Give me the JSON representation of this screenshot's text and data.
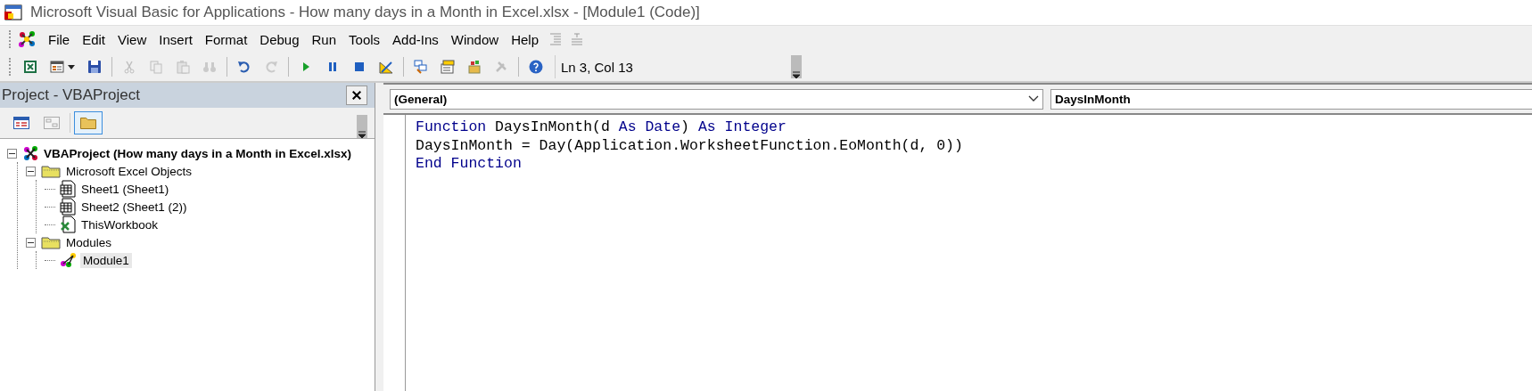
{
  "window": {
    "title": "Microsoft Visual Basic for Applications - How many days in a Month in Excel.xlsx - [Module1 (Code)]"
  },
  "menu": [
    {
      "label": "File"
    },
    {
      "label": "Edit"
    },
    {
      "label": "View"
    },
    {
      "label": "Insert"
    },
    {
      "label": "Format"
    },
    {
      "label": "Debug"
    },
    {
      "label": "Run"
    },
    {
      "label": "Tools"
    },
    {
      "label": "Add-Ins"
    },
    {
      "label": "Window"
    },
    {
      "label": "Help"
    }
  ],
  "menu_extra_buttons": [
    {
      "disabled": true
    },
    {
      "disabled": true
    }
  ],
  "toolbar": {
    "groups": [
      [
        {
          "disabled": false
        },
        {
          "disabled": false
        },
        {
          "disabled": false
        }
      ],
      [
        {
          "disabled": true
        },
        {
          "disabled": true
        },
        {
          "disabled": true
        },
        {
          "disabled": true
        }
      ],
      [
        {
          "disabled": false
        },
        {
          "disabled": true
        }
      ],
      [
        {
          "disabled": false
        },
        {
          "disabled": false
        },
        {
          "disabled": false
        },
        {
          "disabled": false
        }
      ],
      [
        {
          "disabled": false
        },
        {
          "disabled": false
        },
        {
          "disabled": false
        },
        {
          "disabled": true
        }
      ],
      [
        {
          "disabled": false
        }
      ]
    ],
    "position": "Ln 3, Col 13"
  },
  "project_pane": {
    "title": "Project - VBAProject",
    "buttons": [
      {
        "disabled": false,
        "selected": false
      },
      {
        "disabled": true,
        "selected": false
      },
      {
        "disabled": false,
        "selected": true
      }
    ],
    "tree": [
      {
        "label": "VBAProject (How many days in a Month in Excel.xlsx)",
        "kind": "project",
        "expanded": true,
        "selected": false,
        "children": [
          {
            "label": "Microsoft Excel Objects",
            "kind": "folder",
            "expanded": true,
            "selected": false,
            "children": [
              {
                "label": "Sheet1 (Sheet1)",
                "kind": "sheet",
                "selected": false
              },
              {
                "label": "Sheet2 (Sheet1 (2))",
                "kind": "sheet",
                "selected": false
              },
              {
                "label": "ThisWorkbook",
                "kind": "workbook",
                "selected": false
              }
            ]
          },
          {
            "label": "Modules",
            "kind": "folder",
            "expanded": true,
            "selected": false,
            "children": [
              {
                "label": "Module1",
                "kind": "module",
                "selected": true
              }
            ]
          }
        ]
      }
    ]
  },
  "code_window": {
    "object_dropdown": "(General)",
    "procedure_dropdown": "DaysInMonth",
    "lines": [
      [
        {
          "text": "Function",
          "kind": "keyword"
        },
        {
          "text": " DaysInMonth(d ",
          "kind": "plain"
        },
        {
          "text": "As Date",
          "kind": "keyword"
        },
        {
          "text": ") ",
          "kind": "plain"
        },
        {
          "text": "As Integer",
          "kind": "keyword"
        }
      ],
      [
        {
          "text": "DaysInMonth = Day(Application.WorksheetFunction.EoMonth(d, 0))",
          "kind": "plain"
        }
      ],
      [
        {
          "text": "End Function",
          "kind": "keyword"
        }
      ]
    ]
  }
}
